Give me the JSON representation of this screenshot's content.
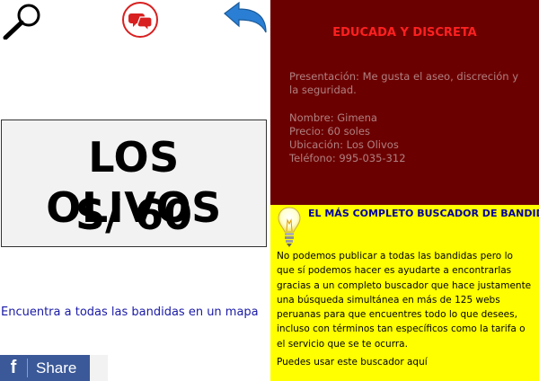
{
  "icons": {
    "search": "search-icon",
    "chat": "chat-icon",
    "back": "back-icon",
    "bulb": "lightbulb-icon",
    "facebook": "facebook-icon"
  },
  "listing": {
    "location": "LOS OLIVOS",
    "price": "S/ 60"
  },
  "map_link": "Encuentra a todas las bandidas en un mapa",
  "share": {
    "glyph": "f",
    "label": "Share",
    "color": "#3b5998"
  },
  "profile": {
    "title": "EDUCADA Y DISCRETA",
    "intro": "Presentación: Me gusta el aseo, discreción y la seguridad.",
    "fields": [
      "Nombre: Gimena",
      "Precio: 60 soles",
      "Ubicación: Los Olivos",
      "Teléfono: 995-035-312"
    ],
    "background_color": "#6b0000",
    "title_color": "#ff2020"
  },
  "promo": {
    "title": "EL MÁS COMPLETO BUSCADOR DE BANDIDAS",
    "text": "No podemos publicar a todas las bandidas pero lo que sí podemos hacer es ayudarte a encontrarlas gracias a un completo buscador que hace justamente una búsqueda simultánea en más de 125 webs peruanas para que encuentres todo lo que desees, incluso con términos tan específicos como la tarifa o el servicio que se te ocurra.",
    "footer": "Puedes usar este buscador aquí",
    "background_color": "#ffff00",
    "title_color": "#0000a0"
  }
}
